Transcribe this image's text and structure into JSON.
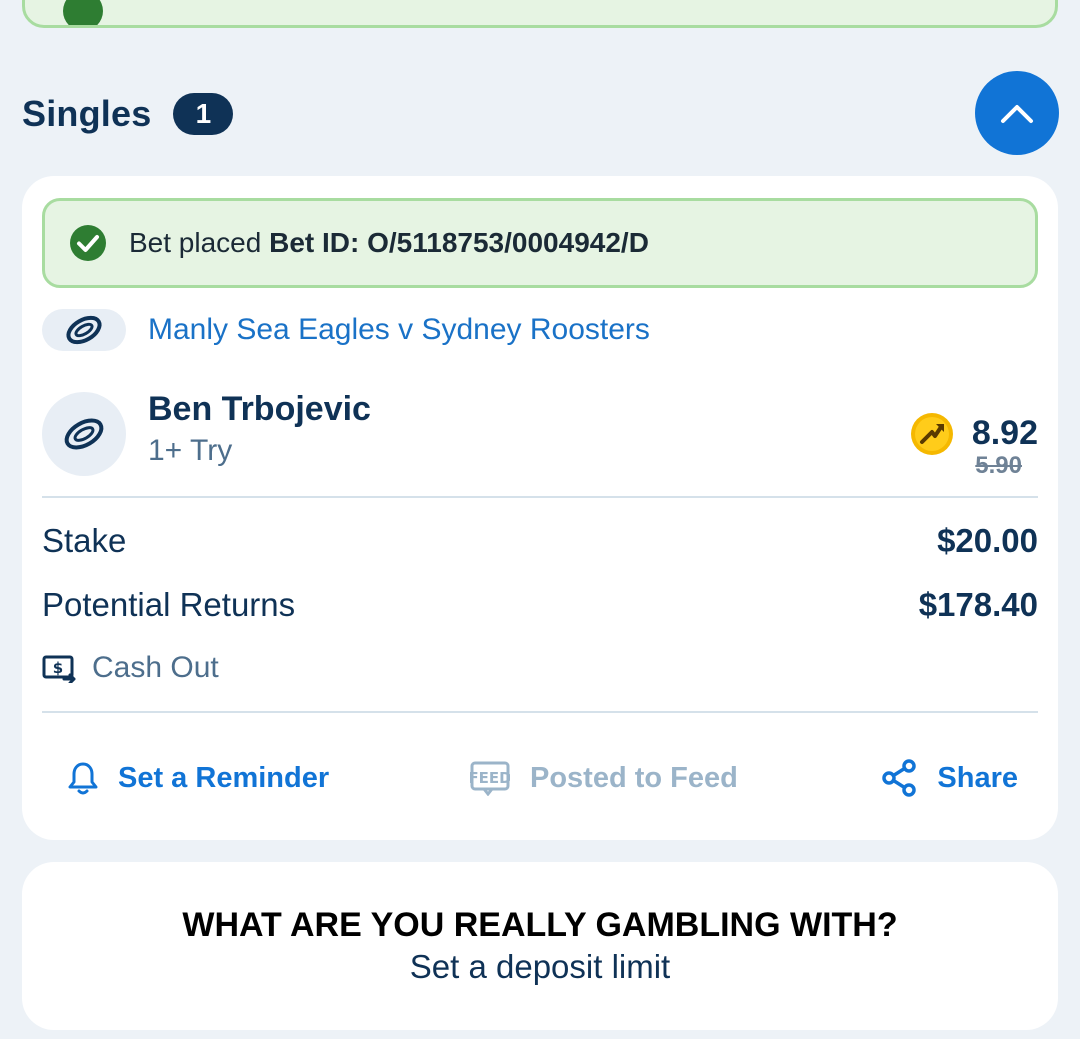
{
  "singles": {
    "title": "Singles",
    "count": "1"
  },
  "bet": {
    "status_prefix": "Bet placed",
    "bet_id": "Bet ID: O/5118753/0004942/D",
    "event": "Manly Sea Eagles v Sydney Roosters",
    "selection": "Ben Trbojevic",
    "market": "1+ Try",
    "odds_boosted": "8.92",
    "odds_original": "5.90",
    "stake_label": "Stake",
    "stake_value": "$20.00",
    "returns_label": "Potential Returns",
    "returns_value": "$178.40",
    "cashout_label": "Cash Out"
  },
  "actions": {
    "reminder": "Set a Reminder",
    "feed": "Posted to Feed",
    "share": "Share"
  },
  "responsible_gambling": {
    "title": "WHAT ARE YOU REALLY GAMBLING WITH?",
    "link": "Set a deposit limit"
  },
  "colors": {
    "brand_navy": "#0f3256",
    "accent_blue": "#1174d6",
    "success_bg": "#e6f4e3",
    "success_border": "#a8dca0",
    "success_icon": "#2e7d32",
    "boost_yellow": "#f5b800"
  },
  "icons": [
    "check-circle-icon",
    "nrl-league-icon",
    "chevron-up-icon",
    "odds-boost-icon",
    "cash-out-icon",
    "bell-icon",
    "feed-icon",
    "share-icon"
  ]
}
